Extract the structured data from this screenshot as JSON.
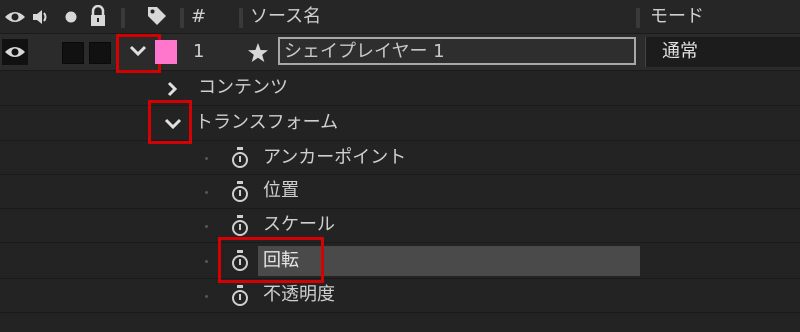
{
  "header": {
    "number_label": "#",
    "source_name_label": "ソース名",
    "mode_label": "モード"
  },
  "layer": {
    "index": "1",
    "name": "シェイプレイヤー 1",
    "mode": "通常",
    "label_color": "#ff77cc"
  },
  "groups": {
    "contents": "コンテンツ",
    "transform": "トランスフォーム"
  },
  "properties": [
    {
      "label": "アンカーポイント"
    },
    {
      "label": "位置"
    },
    {
      "label": "スケール"
    },
    {
      "label": "回転"
    },
    {
      "label": "不透明度"
    }
  ],
  "colors": {
    "highlight": "#d20000",
    "panel_bg": "#232323",
    "selected_row_bg": "#4a4a4a"
  }
}
